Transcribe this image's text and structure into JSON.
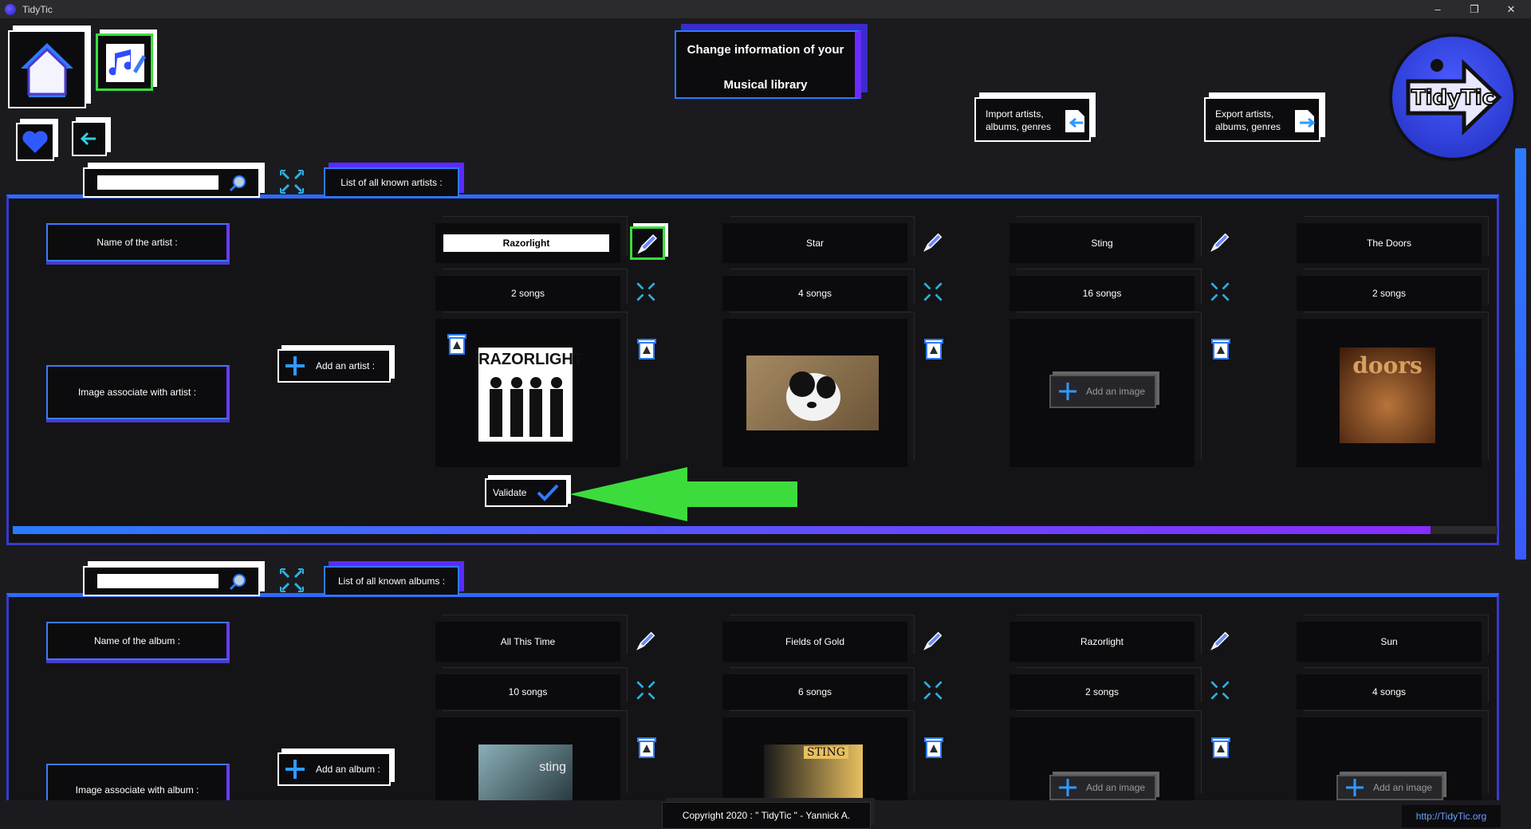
{
  "window": {
    "title": "TidyTic",
    "minimize": "–",
    "restore": "❐",
    "close": "✕"
  },
  "header": {
    "title_line1": "Change information of your",
    "title_line2": "Musical library",
    "import_line1": "Import artists,",
    "import_line2": "albums, genres",
    "export_line1": "Export artists,",
    "export_line2": "albums, genres",
    "logo_text": "TidyTic"
  },
  "artists": {
    "search_placeholder": "",
    "list_title": "List of all known artists :",
    "name_label": "Name of the artist :",
    "image_label": "Image associate with artist :",
    "add_label": "Add an artist :",
    "validate_label": "Validate",
    "items": [
      {
        "name": "Razorlight",
        "songs": "2 songs",
        "editing": true,
        "image": "RAZORLIGHT"
      },
      {
        "name": "Star",
        "songs": "4 songs",
        "editing": false,
        "image": ""
      },
      {
        "name": "Sting",
        "songs": "16 songs",
        "editing": false,
        "image": "",
        "add_image": "Add an image"
      },
      {
        "name": "The Doors",
        "songs": "2 songs",
        "editing": false,
        "image": "doors"
      }
    ]
  },
  "albums": {
    "search_placeholder": "",
    "list_title": "List of all known albums :",
    "name_label": "Name of the album :",
    "image_label": "Image associate with album :",
    "add_label": "Add an album :",
    "items": [
      {
        "name": "All This Time",
        "songs": "10 songs",
        "image": "sting"
      },
      {
        "name": "Fields of Gold",
        "songs": "6 songs",
        "image": "STING"
      },
      {
        "name": "Razorlight",
        "songs": "2 songs",
        "add_image": "Add an image"
      },
      {
        "name": "Sun",
        "songs": "4 songs",
        "add_image": "Add an image"
      }
    ]
  },
  "footer": {
    "copyright": "Copyright 2020 : \" TidyTic \" - Yannick A.",
    "link": "http://TidyTic.org"
  },
  "colors": {
    "accent_blue": "#2b7bff",
    "accent_purple": "#6a2bff",
    "arrow_green": "#3ddc3d"
  }
}
